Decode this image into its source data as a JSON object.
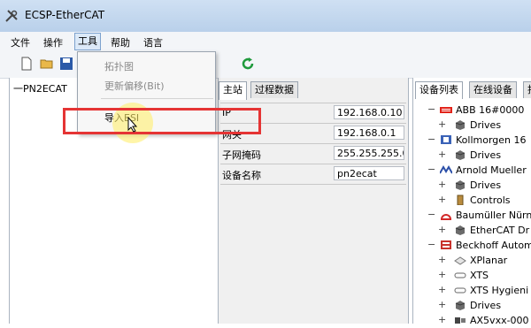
{
  "window": {
    "title": "ECSP-EtherCAT",
    "app_icon": "ethercat-tool-icon"
  },
  "menu": {
    "file": "文件",
    "operate": "操作",
    "tools": "工具",
    "help": "帮助",
    "language": "语言"
  },
  "toolbar": {
    "icons": [
      "new-file-icon",
      "open-folder-icon",
      "save-icon",
      "refresh-icon"
    ]
  },
  "tree": {
    "root": "一PN2ECAT"
  },
  "dropdown": {
    "items": [
      {
        "label": "拓扑图",
        "enabled": false
      },
      {
        "label": "更新偏移(Bit)",
        "enabled": false
      },
      {
        "label": "导入ESI",
        "enabled": true
      }
    ]
  },
  "master": {
    "tabs": [
      "主站",
      "过程数据"
    ],
    "props": [
      {
        "key": "IP",
        "value": "192.168.0.10"
      },
      {
        "key": "网关",
        "value": "192.168.0.1"
      },
      {
        "key": "子网掩码",
        "value": "255.255.255.0"
      },
      {
        "key": "设备名称",
        "value": "pn2ecat"
      }
    ]
  },
  "devices": {
    "tabs": [
      "设备列表",
      "在线设备",
      "拍"
    ],
    "items": [
      {
        "toggle": "−",
        "label": "ABB  16#0000",
        "icon": "abb-logo-icon",
        "color": "#e2231a"
      },
      {
        "toggle": "+",
        "label": "Drives",
        "icon": "drive-box-icon"
      },
      {
        "toggle": "−",
        "label": "Kollmorgen  16",
        "icon": "kollmorgen-logo-icon",
        "color": "#3a62b7"
      },
      {
        "toggle": "+",
        "label": "Drives",
        "icon": "drive-box-icon"
      },
      {
        "toggle": "−",
        "label": "Arnold Mueller",
        "icon": "arnold-mueller-logo-icon",
        "color": "#2b4fa8"
      },
      {
        "toggle": "+",
        "label": "Drives",
        "icon": "drive-box-icon"
      },
      {
        "toggle": "+",
        "label": "Controls",
        "icon": "controls-icon"
      },
      {
        "toggle": "−",
        "label": "Baumüller Nürn",
        "icon": "baumueller-logo-icon",
        "color": "#d22a2a"
      },
      {
        "toggle": "+",
        "label": "EtherCAT Dr",
        "icon": "drive-box-icon"
      },
      {
        "toggle": "−",
        "label": "Beckhoff Autom",
        "icon": "beckhoff-logo-icon",
        "color": "#c8322c"
      },
      {
        "toggle": "+",
        "label": "XPlanar",
        "icon": "xplanar-icon"
      },
      {
        "toggle": "+",
        "label": "XTS",
        "icon": "xts-icon"
      },
      {
        "toggle": "+",
        "label": "XTS Hygieni",
        "icon": "xts-icon"
      },
      {
        "toggle": "+",
        "label": "Drives",
        "icon": "drive-box-icon"
      },
      {
        "toggle": "+",
        "label": "AX5vxx-000",
        "icon": "ax5-drive-icon"
      }
    ]
  }
}
